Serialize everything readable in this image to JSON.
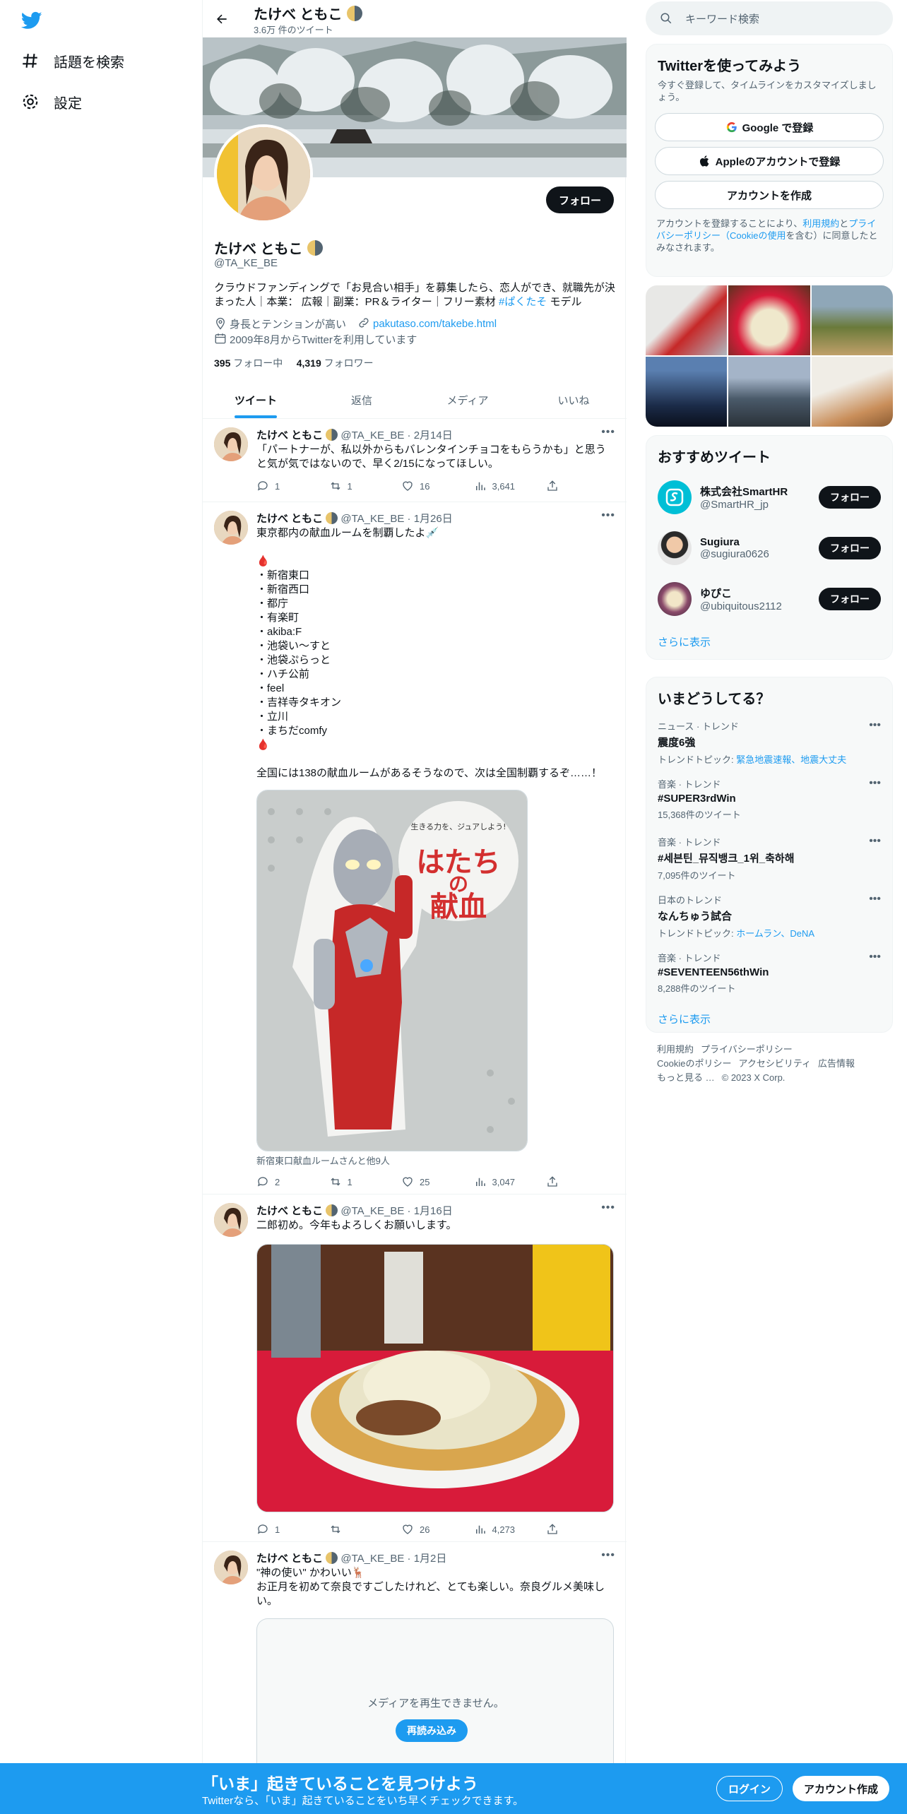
{
  "nav": {
    "explore_label": "話題を検索",
    "settings_label": "設定"
  },
  "profile": {
    "name": "たけべ ともこ",
    "tweet_count": "3.6万 件のツイート",
    "handle": "@TA_KE_BE",
    "follow_label": "フォロー",
    "bio_text": "クラウドファンディングで「お見合い相手」を募集したら、恋人ができ、就職先が決まった人｜本業： 広報｜副業：PR＆ライター｜フリー素材 ",
    "bio_hashtag": "#ぱくたそ",
    "bio_tail": " モデル",
    "location": "身長とテンションが高い",
    "url": "pakutaso.com/takebe.html",
    "joined": "2009年8月からTwitterを利用しています",
    "following_count": "395",
    "following_label": "フォロー中",
    "followers_count": "4,319",
    "followers_label": "フォロワー"
  },
  "tabs": [
    "ツイート",
    "返信",
    "メディア",
    "いいね"
  ],
  "tweets": [
    {
      "name": "たけべ ともこ",
      "handle": "@TA_KE_BE",
      "date": "2月14日",
      "text": "「パートナーが、私以外からもバレンタインチョコをもらうかも」と思うと気が気ではないので、早く2/15になってほしい。",
      "replies": "1",
      "retweets": "1",
      "likes": "16",
      "views": "3,641"
    },
    {
      "name": "たけべ ともこ",
      "handle": "@TA_KE_BE",
      "date": "1月26日",
      "text": "東京都内の献血ルームを制覇したよ💉\n\n🩸\n・新宿東口\n・新宿西口\n・都庁\n・有楽町\n・akiba:F\n・池袋い～すと\n・池袋ぷらっと\n・ハチ公前\n・feel\n・吉祥寺タキオン\n・立川\n・まちだcomfy\n🩸\n\n全国には138の献血ルームがあるそうなので、次は全国制覇するぞ……！",
      "media_tag_line": "生きる力を、ジュアしよう!",
      "media_title_line1": "はたち",
      "media_title_line2": "の",
      "media_title_line3": "献血",
      "caption": "新宿東口献血ルームさんと他9人",
      "replies": "2",
      "retweets": "1",
      "likes": "25",
      "views": "3,047"
    },
    {
      "name": "たけべ ともこ",
      "handle": "@TA_KE_BE",
      "date": "1月16日",
      "text": "二郎初め。今年もよろしくお願いします。",
      "replies": "1",
      "retweets": "",
      "likes": "26",
      "views": "4,273"
    },
    {
      "name": "たけべ ともこ",
      "handle": "@TA_KE_BE",
      "date": "1月2日",
      "text": "\"神の使い\" かわいい🦌\nお正月を初めて奈良ですごしたけれど、とても楽しい。奈良グルメ美味しい。",
      "media_error": "メディアを再生できません。",
      "reload_label": "再読み込み"
    }
  ],
  "search": {
    "placeholder": "キーワード検索"
  },
  "signup": {
    "title": "Twitterを使ってみよう",
    "subtitle": "今すぐ登録して、タイムラインをカスタマイズしましょう。",
    "google": "Google で登録",
    "apple": "Appleのアカウントで登録",
    "create": "アカウントを作成",
    "note_a": "アカウントを登録することにより、",
    "terms": "利用規約",
    "note_b": "と",
    "privacy": "プライバシーポリシー（Cookieの使用",
    "note_c": "を含む）に同意したとみなされます。"
  },
  "recommend": {
    "title": "おすすめツイート",
    "accounts": [
      {
        "name": "株式会社SmartHR",
        "handle": "@SmartHR_jp",
        "btn": "フォロー"
      },
      {
        "name": "Sugiura",
        "handle": "@sugiura0626",
        "btn": "フォロー"
      },
      {
        "name": "ゆぴこ",
        "handle": "@ubiquitous2112",
        "btn": "フォロー"
      }
    ],
    "more": "さらに表示"
  },
  "trends": {
    "title": "いまどうしてる？",
    "items": [
      {
        "cat": "ニュース · トレンド",
        "name": "震度6強",
        "sub_label": "トレンドトピック: ",
        "sub_link": "緊急地震速報、地震大丈夫"
      },
      {
        "cat": "音楽 · トレンド",
        "name": "#SUPER3rdWin",
        "sub": "15,368件のツイート"
      },
      {
        "cat": "音楽 · トレンド",
        "name": "#세븐틴_뮤직뱅크_1위_축하해",
        "sub": "7,095件のツイート"
      },
      {
        "cat": "日本のトレンド",
        "name": "なんちゅう試合",
        "sub_label": "トレンドトピック: ",
        "sub_link": "ホームラン、DeNA"
      },
      {
        "cat": "音楽 · トレンド",
        "name": "#SEVENTEEN56thWin",
        "sub": "8,288件のツイート"
      }
    ],
    "more": "さらに表示"
  },
  "footer": {
    "links": [
      "利用規約",
      "プライバシーポリシー",
      "Cookieのポリシー",
      "アクセシビリティ",
      "広告情報",
      "もっと見る …"
    ],
    "copyright": "© 2023 X Corp."
  },
  "bottom": {
    "title": "「いま」起きていることを見つけよう",
    "subtitle": "Twitterなら、「いま」起きていることをいち早くチェックできます。",
    "login": "ログイン",
    "signup": "アカウント作成"
  },
  "colors": {
    "accent": "#1d9bf0",
    "text": "#0f1419",
    "muted": "#536471"
  }
}
